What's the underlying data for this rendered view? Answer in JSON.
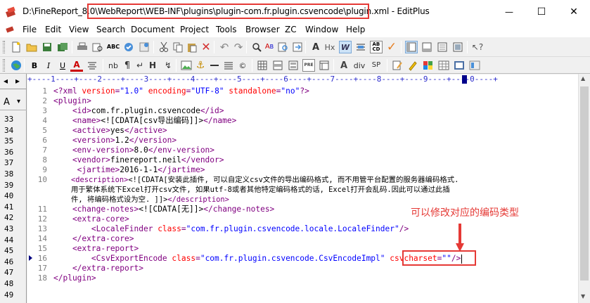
{
  "window": {
    "title": "D:\\FineReport_8.0\\WebReport\\WEB-INF\\plugins\\plugin-com.fr.plugin.csvencode\\plugin.xml - EditPlus",
    "title_prefix": "D:\\FineReport_8.0\\",
    "title_highlight": "WebReport\\WEB-INF\\plugins\\plugin-com.fr.plugin.csvencode\\plugin.xml",
    "title_suffix": " - EditPlus"
  },
  "window_controls": {
    "minimize": "—",
    "maximize": "☐",
    "close": "✕"
  },
  "menu": [
    "File",
    "Edit",
    "View",
    "Search",
    "Document",
    "Project",
    "Tools",
    "Browser",
    "ZC",
    "Window",
    "Help"
  ],
  "mdi_controls": [
    "_",
    "▫",
    "×"
  ],
  "toolbar2": {
    "bold": "B",
    "italic": "I",
    "underline": "U",
    "font": "A",
    "nb": "nb",
    "p": "¶",
    "hr": "H",
    "anchor": "⚓",
    "pre": "PRE",
    "heading": "A",
    "div": "div",
    "sp": "SP"
  },
  "left_pane": {
    "nav_left": "◂",
    "nav_right": "▸",
    "font_label": "A",
    "font_arrow": "▾",
    "numbers": [
      "33",
      "34",
      "35",
      "36",
      "37",
      "38",
      "39",
      "40",
      "41",
      "42",
      "43",
      "44",
      "45",
      "46",
      "47",
      "48",
      "49"
    ]
  },
  "ruler": "+----1----+----2----+----3----+----4----+----5----+----6----+----7----+----8----+----9----+----0----+",
  "gutter": [
    "1",
    "2",
    "3",
    "4",
    "5",
    "6",
    "7",
    "8",
    "9",
    "10",
    "",
    "",
    "11",
    "12",
    "13",
    "14",
    "15",
    "16",
    "17",
    "18"
  ],
  "code": {
    "l1": {
      "a": "<?xml ",
      "b": "version",
      "c": "=",
      "d": "\"1.0\"",
      "e": " encoding",
      "f": "=",
      "g": "\"UTF-8\"",
      "h": " standalone",
      "i": "=",
      "j": "\"no\"",
      "k": "?>"
    },
    "l2": "<plugin>",
    "l3": {
      "open": "    <id>",
      "text": "com.fr.plugin.csvencode",
      "close": "</id>"
    },
    "l4": {
      "open": "    <name>",
      "text": "<![CDATA[csv导出编码]]>",
      "close": "</name>"
    },
    "l5": {
      "open": "    <active>",
      "text": "yes",
      "close": "</active>"
    },
    "l6": {
      "open": "    <version>",
      "text": "1.2",
      "close": "</version>"
    },
    "l7": {
      "open": "    <env-version>",
      "text": "8.0",
      "close": "</env-version>"
    },
    "l8": {
      "open": "    <vendor>",
      "text": "finereport.neil",
      "close": "</vendor>"
    },
    "l9": {
      "open": "     <jartime>",
      "text": "2016-1-1",
      "close": "</jartime>"
    },
    "l10": {
      "open": "    <description>",
      "text": "<![CDATA[安装此插件, 可以自定义csv文件的导出编码格式, 而不用管平台配置的服务器编码格式."
    },
    "l10b": "    用于繁体系统下Excel打开csv文件, 如果utf-8或者其他特定编码格式的话, Excel打开会乱码.因此可以通过此插",
    "l10c": {
      "text": "    件, 将编码格式设为空. ]]>",
      "close": "</description>"
    },
    "l11": {
      "open": "    <change-notes>",
      "text": "<![CDATA[无]]>",
      "close": "</change-notes>"
    },
    "l12": "    <extra-core>",
    "l13": {
      "open": "        <LocaleFinder",
      "attr": " class",
      "eq": "=",
      "val": "\"com.fr.plugin.csvencode.locale.LocaleFinder\"",
      "close": "/>"
    },
    "l14": "    </extra-core>",
    "l15": "    <extra-report>",
    "l16": {
      "open": "        <CsvExportEncode",
      "attr": " class",
      "eq": "=",
      "val": "\"com.fr.plugin.csvencode.CsvEncodeImpl\"",
      "attr2": " csvcharset",
      "eq2": "=",
      "val2": "\"\"",
      "close": "/>"
    },
    "l17": "    </extra-report>",
    "l18": "</plugin>"
  },
  "annotation": "可以修改对应的编码类型",
  "colors": {
    "tag": "#800080",
    "attr": "#ff0000",
    "value": "#0000ff",
    "highlight": "#e53935"
  }
}
